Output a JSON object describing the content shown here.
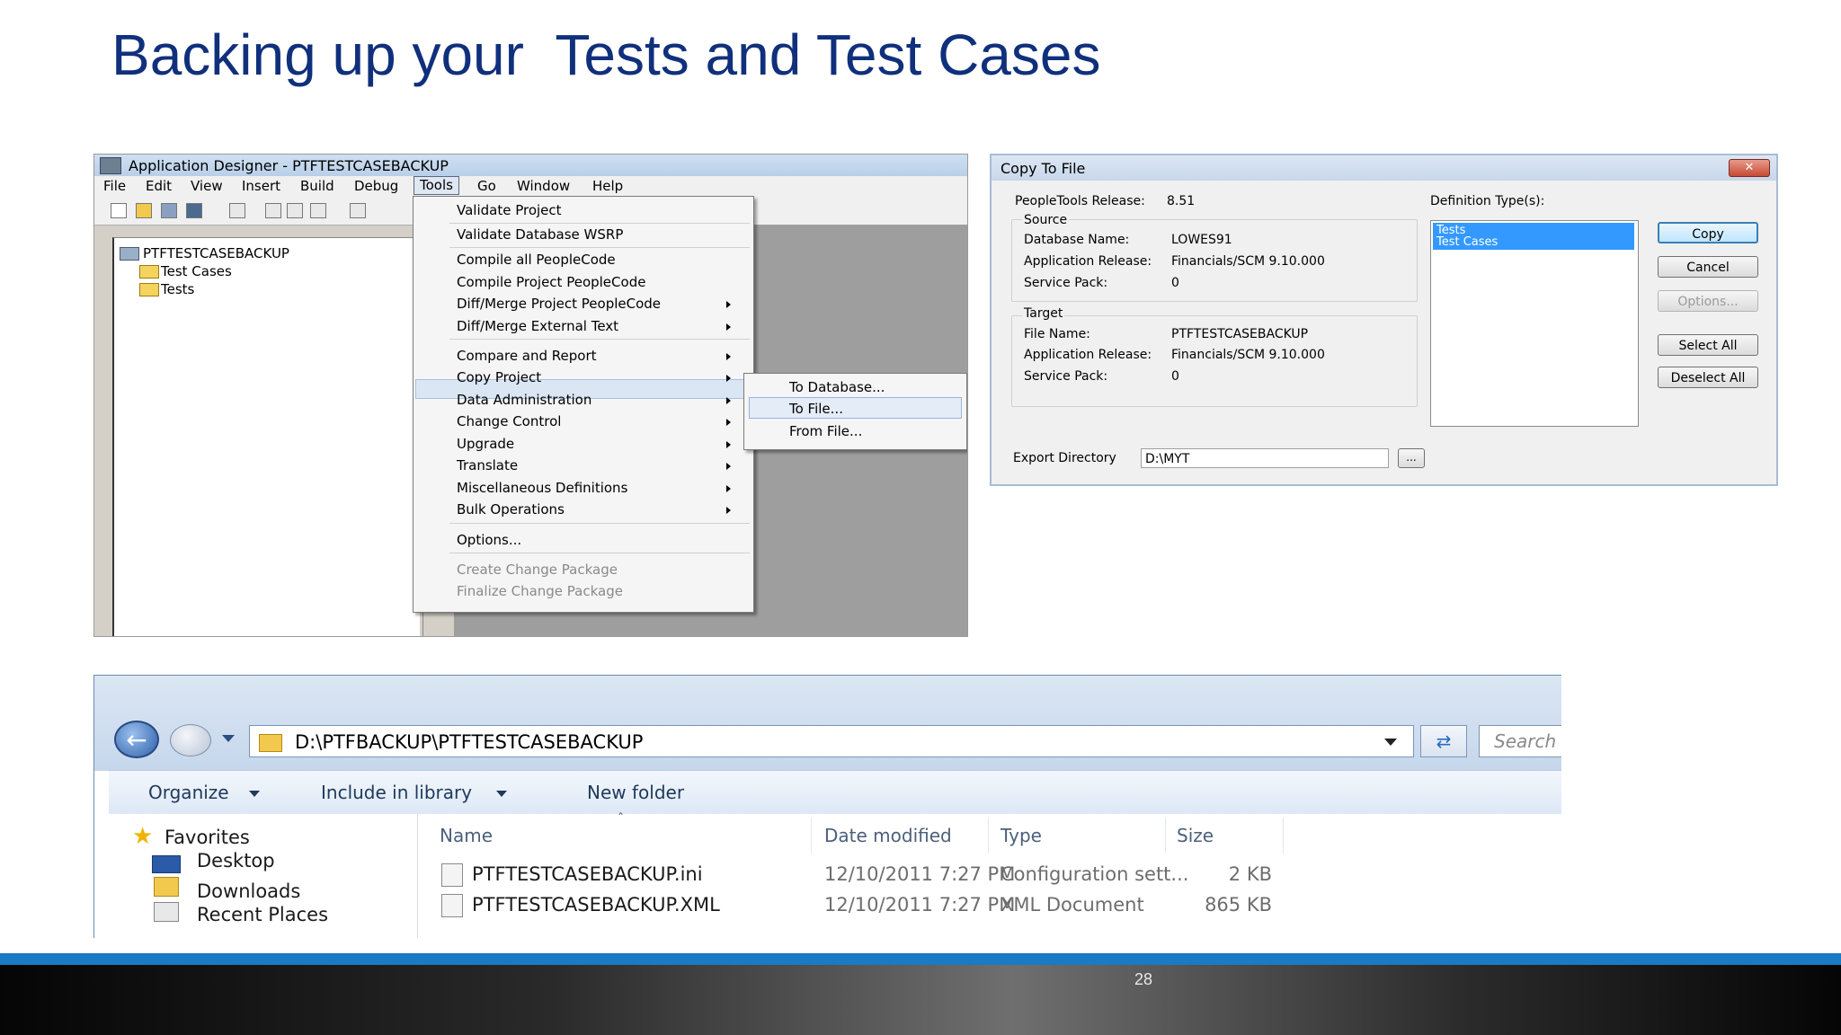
{
  "slide": {
    "title": "Backing up your  Tests and Test Cases",
    "page_number": "28"
  },
  "app_designer": {
    "title": "Application Designer - PTFTESTCASEBACKUP",
    "menus": [
      "File",
      "Edit",
      "View",
      "Insert",
      "Build",
      "Debug",
      "Tools",
      "Go",
      "Window",
      "Help"
    ],
    "tree": {
      "root": "PTFTESTCASEBACKUP",
      "children": [
        "Test Cases",
        "Tests"
      ]
    },
    "tools_menu": {
      "items": [
        {
          "label": "Validate Project"
        },
        {
          "label": "Validate Database WSRP"
        },
        {
          "label": "Compile all PeopleCode"
        },
        {
          "label": "Compile Project PeopleCode"
        },
        {
          "label": "Diff/Merge Project PeopleCode"
        },
        {
          "label": "Diff/Merge External Text"
        },
        {
          "label": "Compare and Report"
        },
        {
          "label": "Copy Project"
        },
        {
          "label": "Data Administration"
        },
        {
          "label": "Change Control"
        },
        {
          "label": "Upgrade"
        },
        {
          "label": "Translate"
        },
        {
          "label": "Miscellaneous Definitions"
        },
        {
          "label": "Bulk Operations"
        },
        {
          "label": "Options..."
        },
        {
          "label": "Create Change Package"
        },
        {
          "label": "Finalize Change Package"
        }
      ]
    },
    "copy_project_submenu": [
      "To Database...",
      "To File...",
      "From File..."
    ]
  },
  "copy_to_file": {
    "title": "Copy To File",
    "close_label": "✕",
    "peopletools_release_label": "PeopleTools Release:",
    "peopletools_release": "8.51",
    "source_label": "Source",
    "source": {
      "db_name_label": "Database Name:",
      "db_name": "LOWES91",
      "app_release_label": "Application Release:",
      "app_release": "Financials/SCM 9.10.000",
      "service_pack_label": "Service Pack:",
      "service_pack": "0"
    },
    "target_label": "Target",
    "target": {
      "file_name_label": "File Name:",
      "file_name": "PTFTESTCASEBACKUP",
      "app_release_label": "Application Release:",
      "app_release": "Financials/SCM 9.10.000",
      "service_pack_label": "Service Pack:",
      "service_pack": "0"
    },
    "definition_types_label": "Definition Type(s):",
    "definition_types": [
      "Tests",
      "Test Cases"
    ],
    "buttons": {
      "copy": "Copy",
      "cancel": "Cancel",
      "options": "Options...",
      "select_all": "Select All",
      "deselect_all": "Deselect All"
    },
    "export_directory_label": "Export Directory",
    "export_directory": "D:\\MYT",
    "browse_label": "..."
  },
  "explorer": {
    "address": "D:\\PTFBACKUP\\PTFTESTCASEBACKUP",
    "search_placeholder": "Search",
    "commands": {
      "organize": "Organize",
      "include_in_library": "Include in library",
      "new_folder": "New folder"
    },
    "nav": {
      "favorites": "Favorites",
      "desktop": "Desktop",
      "downloads": "Downloads",
      "recent_places": "Recent Places"
    },
    "columns": {
      "name": "Name",
      "date_modified": "Date modified",
      "type": "Type",
      "size": "Size"
    },
    "files": [
      {
        "name": "PTFTESTCASEBACKUP.ini",
        "date": "12/10/2011 7:27 PM",
        "type": "Configuration sett...",
        "size": "2 KB"
      },
      {
        "name": "PTFTESTCASEBACKUP.XML",
        "date": "12/10/2011 7:27 PM",
        "type": "XML Document",
        "size": "865 KB"
      }
    ]
  },
  "colors": {
    "title_blue": "#10307c",
    "footer_accent": "#1a7ac4",
    "selection_blue": "#3399ff"
  }
}
